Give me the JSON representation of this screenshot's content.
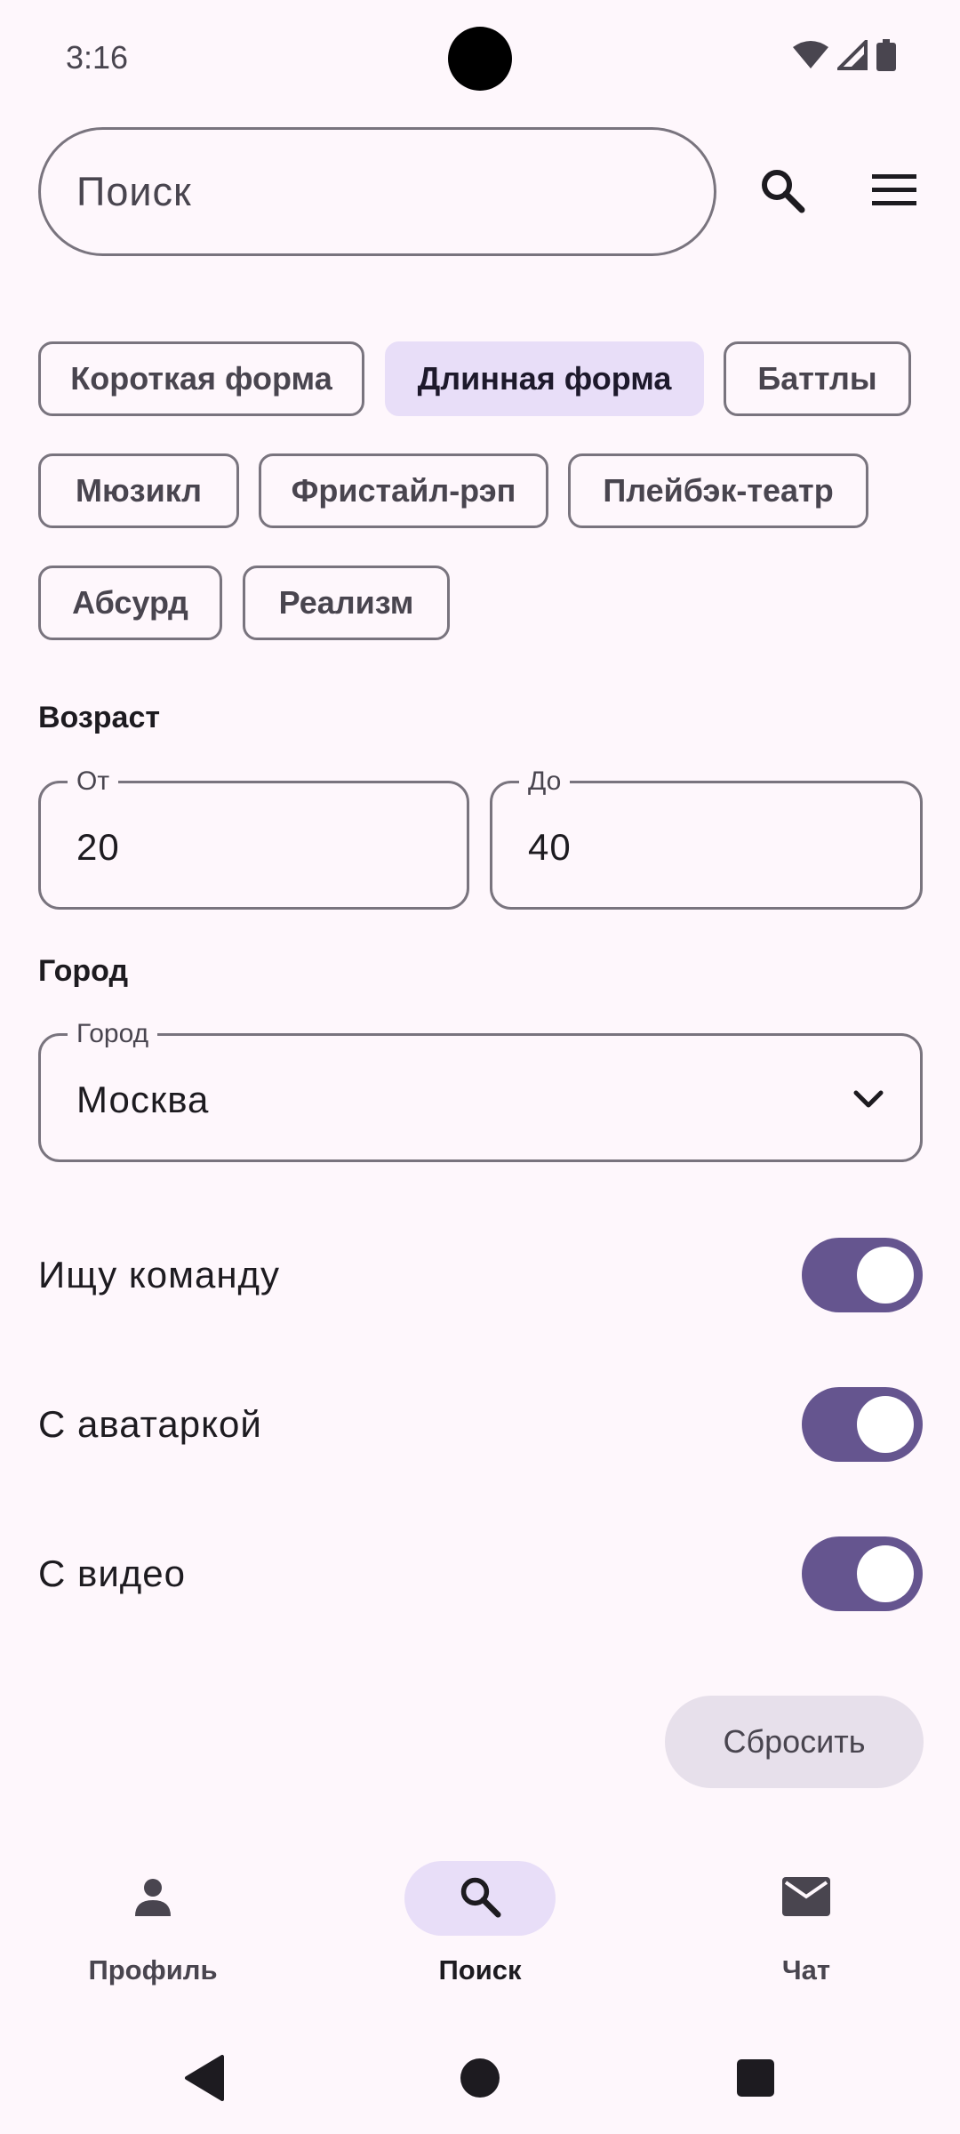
{
  "status_bar": {
    "time": "3:16"
  },
  "search": {
    "placeholder": "Поиск"
  },
  "chips": [
    {
      "label": "Короткая форма",
      "selected": false
    },
    {
      "label": "Длинная форма",
      "selected": true
    },
    {
      "label": "Баттлы",
      "selected": false
    },
    {
      "label": "Мюзикл",
      "selected": false
    },
    {
      "label": "Фристайл-рэп",
      "selected": false
    },
    {
      "label": "Плейбэк-театр",
      "selected": false
    },
    {
      "label": "Абсурд",
      "selected": false
    },
    {
      "label": "Реализм",
      "selected": false
    }
  ],
  "age": {
    "title": "Возраст",
    "from_label": "От",
    "from_value": "20",
    "to_label": "До",
    "to_value": "40"
  },
  "city": {
    "title": "Город",
    "field_label": "Город",
    "value": "Москва"
  },
  "toggles": [
    {
      "label": "Ищу команду",
      "on": true
    },
    {
      "label": "С аватаркой",
      "on": true
    },
    {
      "label": "С видео",
      "on": true
    }
  ],
  "reset_label": "Сбросить",
  "bottom_nav": [
    {
      "label": "Профиль",
      "icon": "person-icon",
      "active": false
    },
    {
      "label": "Поиск",
      "icon": "search-icon",
      "active": true
    },
    {
      "label": "Чат",
      "icon": "mail-icon",
      "active": false
    }
  ],
  "colors": {
    "background": "#fef7fc",
    "accent": "#65558f",
    "chip_selected": "#e8def8",
    "outline": "#79747e"
  }
}
